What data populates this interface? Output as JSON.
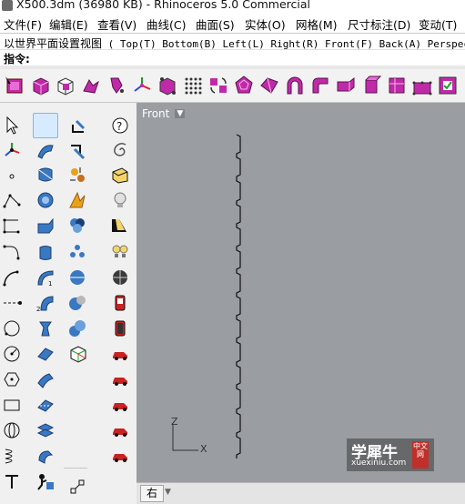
{
  "window": {
    "title": "X500.3dm (36980 KB) - Rhinoceros 5.0 Commercial"
  },
  "menu": [
    {
      "label": "文件(F)"
    },
    {
      "label": "编辑(E)"
    },
    {
      "label": "查看(V)"
    },
    {
      "label": "曲线(C)"
    },
    {
      "label": "曲面(S)"
    },
    {
      "label": "实体(O)"
    },
    {
      "label": "网格(M)"
    },
    {
      "label": "尺寸标注(D)"
    },
    {
      "label": "变动(T)"
    }
  ],
  "command": {
    "history_prefix": "以世界平面设置视图",
    "history_options": "( Top(T) Bottom(B) Left(L) Right(R) Front(F) Back(A) Perspec",
    "prompt_label": "指令:",
    "prompt_value": ""
  },
  "toolbar_icons": [
    "select-points-icon",
    "box-icon",
    "transparent-box-icon",
    "move-icon",
    "rotate-icon",
    "gumball-axis-icon",
    "cube-render-icon",
    "point-grid-icon",
    "cycle-icon",
    "dodecahedron-icon",
    "flow-icon",
    "arch-icon",
    "bend-icon",
    "fold-icon",
    "extrude-icon",
    "panel-icon",
    "control-cage-icon",
    "checkbox-icon",
    "more-icon"
  ],
  "left_col1_icons": [
    "arrow-select-icon",
    "gumball-icon",
    "point-icon",
    "polyline-icon",
    "rectangle-curve-icon",
    "curve-corner-icon",
    "arc-icon",
    "dashed-line-icon",
    "circle-icon",
    "circle-point-icon",
    "polygon-icon",
    "rectangle-icon",
    "cylinder-curve-icon",
    "helix-icon",
    "text-icon"
  ],
  "left_col2_icons": [
    "plane-icon",
    "sweep-icon",
    "revolve-icon",
    "loft-icon",
    "cap-icon",
    "extrude-surface-icon",
    "fillet-surface-icon",
    "patch-icon",
    "blend-surface-icon",
    "network-surface-icon",
    "split-icon",
    "trim-icon",
    "rebuild-icon",
    "offset-surface-icon",
    "unroll-icon"
  ],
  "left_col3_icons": [
    "line-icon",
    "join-icon",
    "explode-icon",
    "boolean-icon",
    "sphere-cluster-icon",
    "sphere-union-icon",
    "sphere-split-icon",
    "sphere-pair-icon",
    "box-edges-icon",
    "curve-end-icon"
  ],
  "left_col4_icons": [
    "help-icon",
    "swirl-icon",
    "save-icon",
    "light-bulb-icon",
    "spot-light-icon",
    "dual-light-icon",
    "render-sphere-icon",
    "red-gauge-icon",
    "dark-gauge-icon",
    "car-icon",
    "car-icon",
    "car-icon",
    "car-icon",
    "car-icon",
    "car-icon"
  ],
  "viewport": {
    "name": "Front",
    "bg_color": "#9a9da2",
    "axis_z": "Z",
    "axis_x": "X"
  },
  "status": {
    "view_tab": "右"
  },
  "watermark": {
    "brand": "学犀牛",
    "domain": "xuexiniu.com",
    "badge": "中文网"
  }
}
